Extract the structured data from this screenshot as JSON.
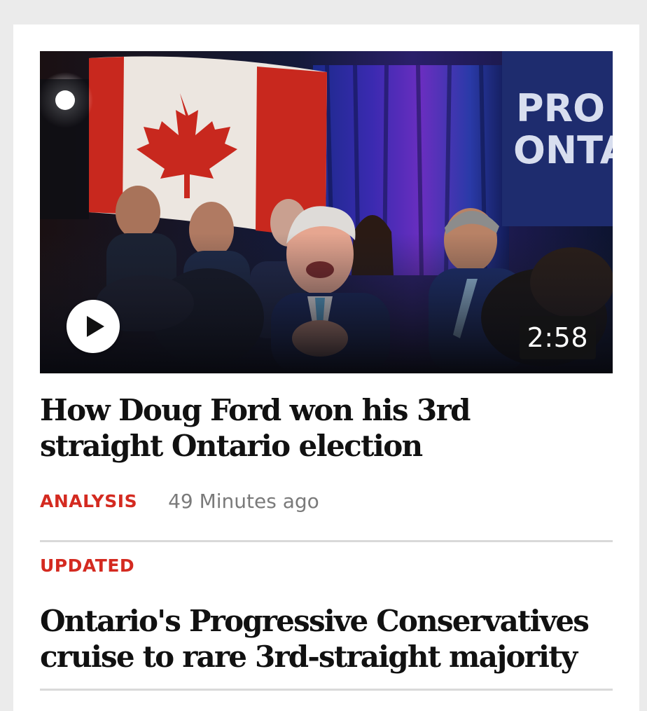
{
  "story_main": {
    "video_duration": "2:58",
    "headline": "How Doug Ford won his 3rd straight Ontario election",
    "category": "ANALYSIS",
    "timestamp": "49 Minutes ago",
    "image_description_icons": [
      "canada-flag",
      "play-icon"
    ],
    "image_text": [
      "PRO",
      "ONTA"
    ]
  },
  "story_secondary": {
    "label": "UPDATED",
    "headline": "Ontario's Progressive Conservatives cruise to rare 3rd-straight majority"
  },
  "colors": {
    "accent_red": "#d42a20",
    "headline_text": "#111111",
    "meta_gray": "#7a7a7a",
    "page_background": "#ebebeb",
    "card_background": "#ffffff"
  }
}
